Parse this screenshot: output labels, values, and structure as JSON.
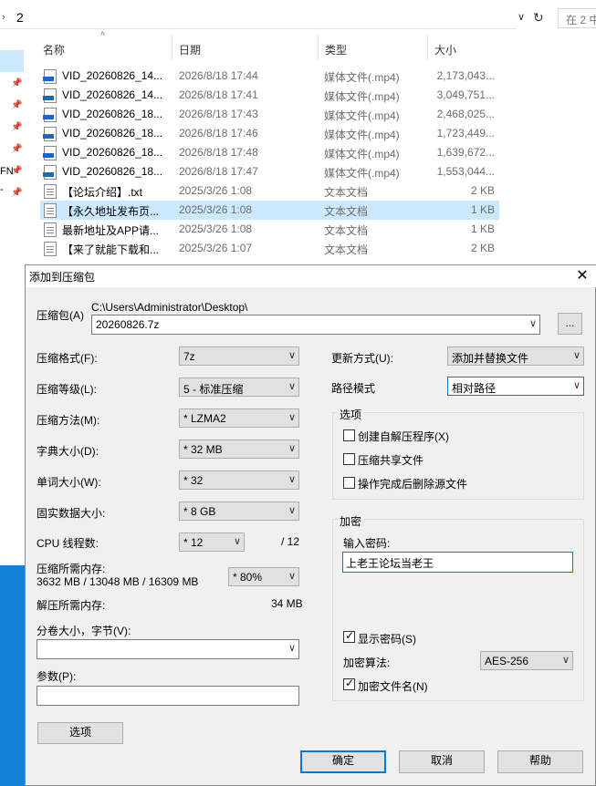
{
  "explorer": {
    "address": "2",
    "search_placeholder": "在 2 中",
    "nav_fragments": [
      "FN",
      "-"
    ],
    "columns": {
      "name": "名称",
      "date": "日期",
      "type": "类型",
      "size": "大小"
    },
    "files": [
      {
        "name": "VID_20260826_14...",
        "date": "2026/8/18 17:44",
        "type": "媒体文件(.mp4)",
        "size": "2,173,043..."
      },
      {
        "name": "VID_20260826_14...",
        "date": "2026/8/18 17:41",
        "type": "媒体文件(.mp4)",
        "size": "3,049,751..."
      },
      {
        "name": "VID_20260826_18...",
        "date": "2026/8/18 17:43",
        "type": "媒体文件(.mp4)",
        "size": "2,468,025..."
      },
      {
        "name": "VID_20260826_18...",
        "date": "2026/8/18 17:46",
        "type": "媒体文件(.mp4)",
        "size": "1,723,449..."
      },
      {
        "name": "VID_20260826_18...",
        "date": "2026/8/18 17:48",
        "type": "媒体文件(.mp4)",
        "size": "1,639,672..."
      },
      {
        "name": "VID_20260826_18...",
        "date": "2026/8/18 17:47",
        "type": "媒体文件(.mp4)",
        "size": "1,553,044..."
      },
      {
        "name": "【论坛介绍】.txt",
        "date": "2025/3/26 1:08",
        "type": "文本文档",
        "size": "2 KB"
      },
      {
        "name": "【永久地址发布页...",
        "date": "2025/3/26 1:08",
        "type": "文本文档",
        "size": "1 KB"
      },
      {
        "name": "最新地址及APP请...",
        "date": "2025/3/26 1:08",
        "type": "文本文档",
        "size": "1 KB"
      },
      {
        "name": "【来了就能下载和...",
        "date": "2025/3/26 1:07",
        "type": "文本文档",
        "size": "2 KB"
      }
    ]
  },
  "dialog": {
    "title": "添加到压缩包",
    "archive_label": "压缩包(A)",
    "archive_path": "C:\\Users\\Administrator\\Desktop\\",
    "archive_name": "20260826.7z",
    "browse_label": "...",
    "format_label": "压缩格式(F):",
    "format_value": "7z",
    "level_label": "压缩等级(L):",
    "level_value": "5 - 标准压缩",
    "method_label": "压缩方法(M):",
    "method_value": "* LZMA2",
    "dict_label": "字典大小(D):",
    "dict_value": "* 32 MB",
    "word_label": "单词大小(W):",
    "word_value": "* 32",
    "solid_label": "固实数据大小:",
    "solid_value": "* 8 GB",
    "cpu_label": "CPU 线程数:",
    "cpu_value": "* 12",
    "cpu_total": "/ 12",
    "mem_comp_label": "压缩所需内存:",
    "mem_comp_detail": "3632 MB / 13048 MB / 16309 MB",
    "mem_percent": "* 80%",
    "mem_decomp_label": "解压所需内存:",
    "mem_decomp_value": "34 MB",
    "volume_label": "分卷大小，字节(V):",
    "volume_value": "",
    "params_label": "参数(P):",
    "params_value": "",
    "options_button": "选项",
    "update_label": "更新方式(U):",
    "update_value": "添加并替换文件",
    "pathmode_label": "路径模式",
    "pathmode_value": "相对路径",
    "options_group": "选项",
    "opt_sfx": "创建自解压程序(X)",
    "opt_shared": "压缩共享文件",
    "opt_delete": "操作完成后删除源文件",
    "encrypt_group": "加密",
    "password_label": "输入密码:",
    "password_value": "上老王论坛当老王",
    "show_password": "显示密码(S)",
    "enc_method_label": "加密算法:",
    "enc_method_value": "AES-256",
    "encrypt_names": "加密文件名(N)",
    "ok": "确定",
    "cancel": "取消",
    "help": "帮助"
  }
}
